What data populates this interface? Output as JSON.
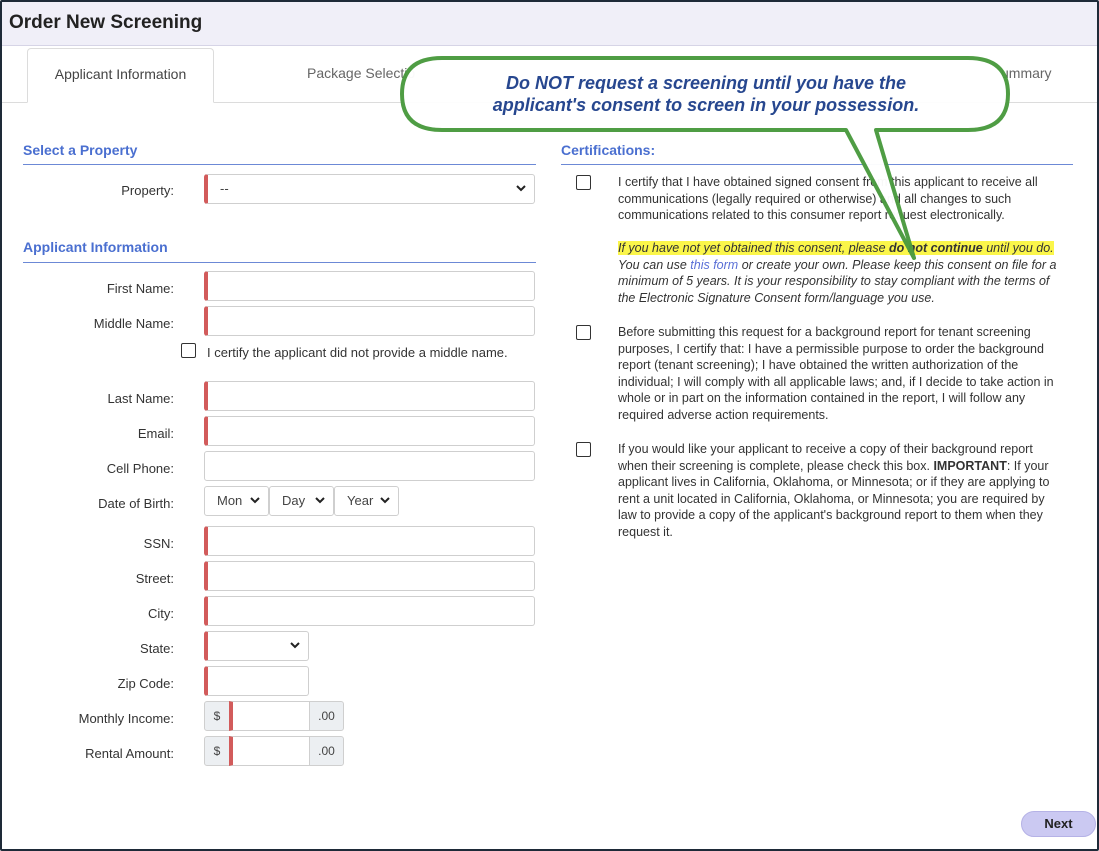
{
  "header": {
    "title": "Order New Screening"
  },
  "tabs": [
    {
      "label": "Applicant Information"
    },
    {
      "label": "Package Selectio"
    },
    {
      "label": "ummary"
    }
  ],
  "callout": {
    "line1": "Do NOT request a screening until you have the",
    "line2": "applicant's consent to screen in your possession."
  },
  "property_section": {
    "title": "Select a Property",
    "property_label": "Property:",
    "property_value": "--"
  },
  "applicant_section": {
    "title": "Applicant Information",
    "first_name_label": "First Name:",
    "middle_name_label": "Middle Name:",
    "no_middle_name_label": "I certify the applicant did not provide a middle name.",
    "last_name_label": "Last Name:",
    "email_label": "Email:",
    "cell_phone_label": "Cell Phone:",
    "dob_label": "Date of Birth:",
    "dob_month": "Mon",
    "dob_day": "Day",
    "dob_year": "Year",
    "ssn_label": "SSN:",
    "street_label": "Street:",
    "city_label": "City:",
    "state_label": "State:",
    "zip_label": "Zip Code:",
    "monthly_income_label": "Monthly Income:",
    "rental_amount_label": "Rental Amount:",
    "currency_symbol": "$",
    "cents_suffix": ".00"
  },
  "certifications": {
    "title": "Certifications:",
    "cert1_text": "I certify that I have obtained signed consent from this applicant to receive all communications (legally required or otherwise) and all changes to such communications related to this consumer report request electronically.",
    "note_part1": "If you have not yet obtained this consent, please ",
    "note_bold": "do not continue",
    "note_part2": " until you do.",
    "note_part3": " You can use ",
    "note_link": "this form",
    "note_part4": " or create your own. Please keep this consent on file for a minimum of 5 years. It is your responsibility to stay compliant with the terms of the Electronic Signature Consent form/language you use.",
    "cert2_text": "Before submitting this request for a background report for tenant screening purposes, I certify that: I have a permissible purpose to order the background report (tenant screening); I have obtained the written authorization of the individual; I will comply with all applicable laws; and, if I decide to take action in whole or in part on the information contained in the report, I will follow any required adverse action requirements.",
    "cert3_part1": "If you would like your applicant to receive a copy of their background report when their screening is complete, please check this box. ",
    "cert3_bold": "IMPORTANT",
    "cert3_part2": ": If your applicant lives in California, Oklahoma, or Minnesota; or if they are applying to rent a unit located in California, Oklahoma, or Minnesota; you are required by law to provide a copy of the applicant's background report to them when they request it."
  },
  "footer": {
    "next_label": "Next"
  },
  "colors": {
    "accent": "#4a6fd0",
    "required": "#d25b5b",
    "callout_border": "#4a9a3e",
    "highlight": "#fbf64a",
    "next_button": "#cbc9f2"
  }
}
